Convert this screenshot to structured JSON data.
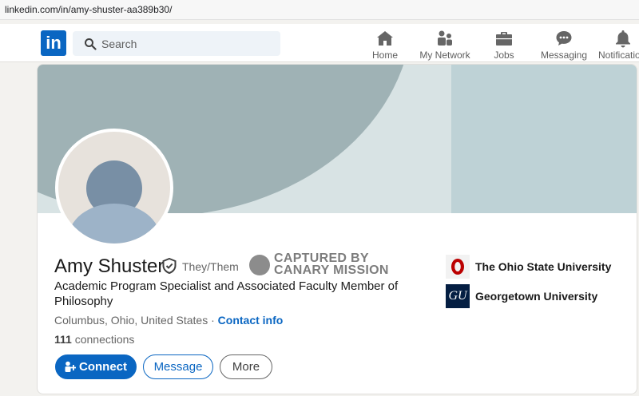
{
  "browser": {
    "url": "linkedin.com/in/amy-shuster-aa389b30/"
  },
  "nav": {
    "logo": "in",
    "search_placeholder": "Search",
    "items": [
      {
        "label": "Home",
        "icon": "home-icon"
      },
      {
        "label": "My Network",
        "icon": "network-icon"
      },
      {
        "label": "Jobs",
        "icon": "briefcase-icon"
      },
      {
        "label": "Messaging",
        "icon": "messaging-icon"
      },
      {
        "label": "Notifications",
        "icon": "bell-icon"
      }
    ]
  },
  "profile": {
    "name": "Amy Shuster",
    "pronouns": "They/Them",
    "headline": "Academic Program Specialist and Associated Faculty Member of Philosophy",
    "location": "Columbus, Ohio, United States",
    "location_sep": " · ",
    "contact_info": "Contact info",
    "connections_count": "111",
    "connections_label": " connections"
  },
  "watermark": {
    "line1": "CAPTURED BY",
    "line2": "CANARY MISSION"
  },
  "actions": {
    "connect": "Connect",
    "message": "Message",
    "more": "More"
  },
  "education": [
    {
      "name": "The Ohio State University",
      "logo_text": "O"
    },
    {
      "name": "Georgetown University",
      "logo_text": "GU"
    }
  ],
  "colors": {
    "brand": "#0a66c2",
    "banner": "#9fb2b5",
    "background": "#f3f2ef"
  }
}
